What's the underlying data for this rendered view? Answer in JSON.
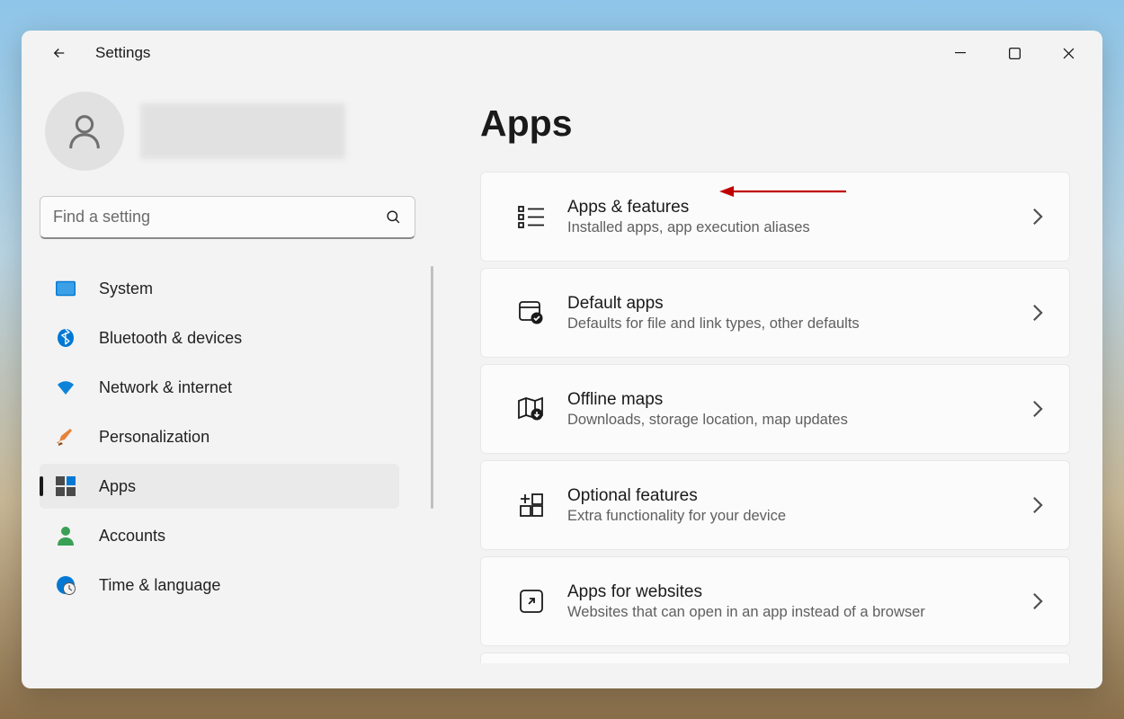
{
  "window": {
    "title": "Settings"
  },
  "search": {
    "placeholder": "Find a setting"
  },
  "sidebar": {
    "items": [
      {
        "label": "System"
      },
      {
        "label": "Bluetooth & devices"
      },
      {
        "label": "Network & internet"
      },
      {
        "label": "Personalization"
      },
      {
        "label": "Apps"
      },
      {
        "label": "Accounts"
      },
      {
        "label": "Time & language"
      }
    ]
  },
  "main": {
    "title": "Apps",
    "cards": [
      {
        "title": "Apps & features",
        "sub": "Installed apps, app execution aliases"
      },
      {
        "title": "Default apps",
        "sub": "Defaults for file and link types, other defaults"
      },
      {
        "title": "Offline maps",
        "sub": "Downloads, storage location, map updates"
      },
      {
        "title": "Optional features",
        "sub": "Extra functionality for your device"
      },
      {
        "title": "Apps for websites",
        "sub": "Websites that can open in an app instead of a browser"
      }
    ]
  }
}
